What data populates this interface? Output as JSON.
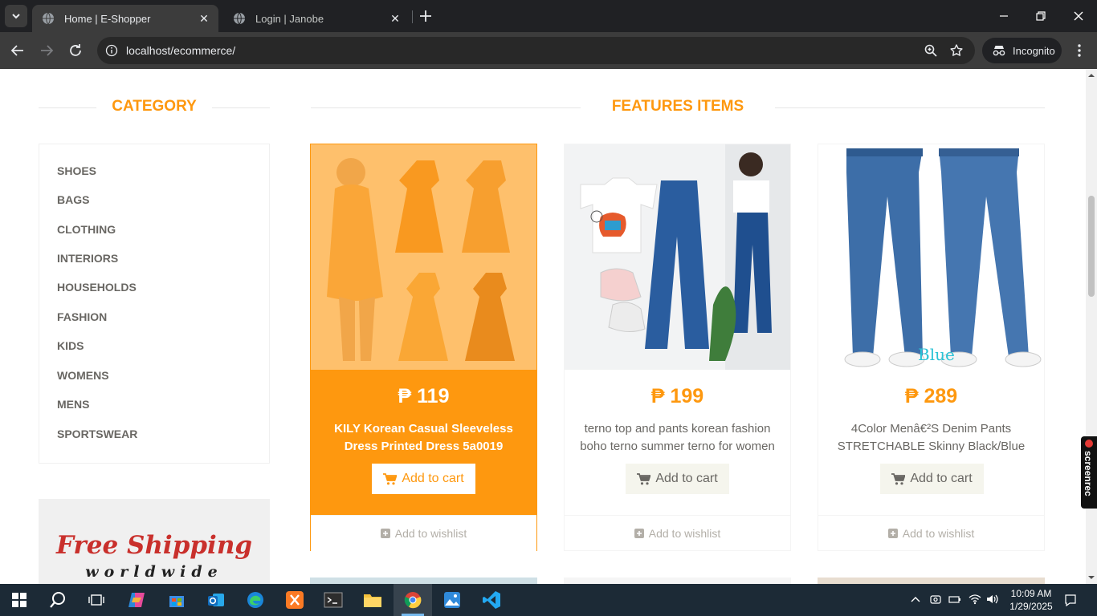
{
  "browser": {
    "tabs": [
      {
        "title": "Home | E-Shopper",
        "active": true
      },
      {
        "title": "Login | Janobe",
        "active": false
      }
    ],
    "url": "localhost/ecommerce/",
    "incognito_label": "Incognito"
  },
  "sidebar": {
    "title": "CATEGORY",
    "categories": [
      "SHOES",
      "BAGS",
      "CLOTHING",
      "INTERIORS",
      "HOUSEHOLDS",
      "FASHION",
      "KIDS",
      "WOMENS",
      "MENS",
      "SPORTSWEAR"
    ],
    "shipping_title": "Free Shipping",
    "shipping_subtitle": "worldwide"
  },
  "features": {
    "title": "FEATURES ITEMS",
    "add_to_cart_label": "Add to cart",
    "add_to_wishlist_label": "Add to wishlist",
    "items": [
      {
        "price": "₱ 119",
        "name": "KILY Korean Casual Sleeveless Dress Printed Dress 5a0019",
        "highlighted": true
      },
      {
        "price": "₱ 199",
        "name": "terno top and pants korean fashion boho terno summer terno for women",
        "highlighted": false
      },
      {
        "price": "₱ 289",
        "name": "4Color Menâ€²S Denim Pants STRETCHABLE Skinny Black/Blue",
        "highlighted": false,
        "image_caption": "Blue"
      }
    ]
  },
  "screenrec_label": "screenrec",
  "taskbar": {
    "time": "10:09 AM",
    "date": "1/29/2025"
  },
  "colors": {
    "accent": "#fe980f",
    "text": "#696763",
    "chrome_bg": "#202124",
    "taskbar_bg": "#1c2a36"
  }
}
